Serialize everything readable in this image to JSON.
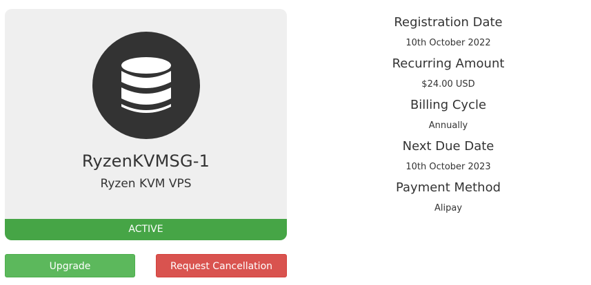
{
  "product": {
    "icon": "database-icon",
    "name": "RyzenKVMSG-1",
    "group": "Ryzen KVM VPS",
    "status": "ACTIVE"
  },
  "actions": {
    "upgrade_label": "Upgrade",
    "cancel_label": "Request Cancellation"
  },
  "details": [
    {
      "label": "Registration Date",
      "value": "10th October 2022"
    },
    {
      "label": "Recurring Amount",
      "value": "$24.00 USD"
    },
    {
      "label": "Billing Cycle",
      "value": "Annually"
    },
    {
      "label": "Next Due Date",
      "value": "10th October 2023"
    },
    {
      "label": "Payment Method",
      "value": "Alipay"
    }
  ],
  "colors": {
    "status_active": "#46a546",
    "upgrade_button": "#5cb85c",
    "cancel_button": "#d9534f",
    "card_background": "#efefef",
    "icon_circle": "#333333"
  }
}
